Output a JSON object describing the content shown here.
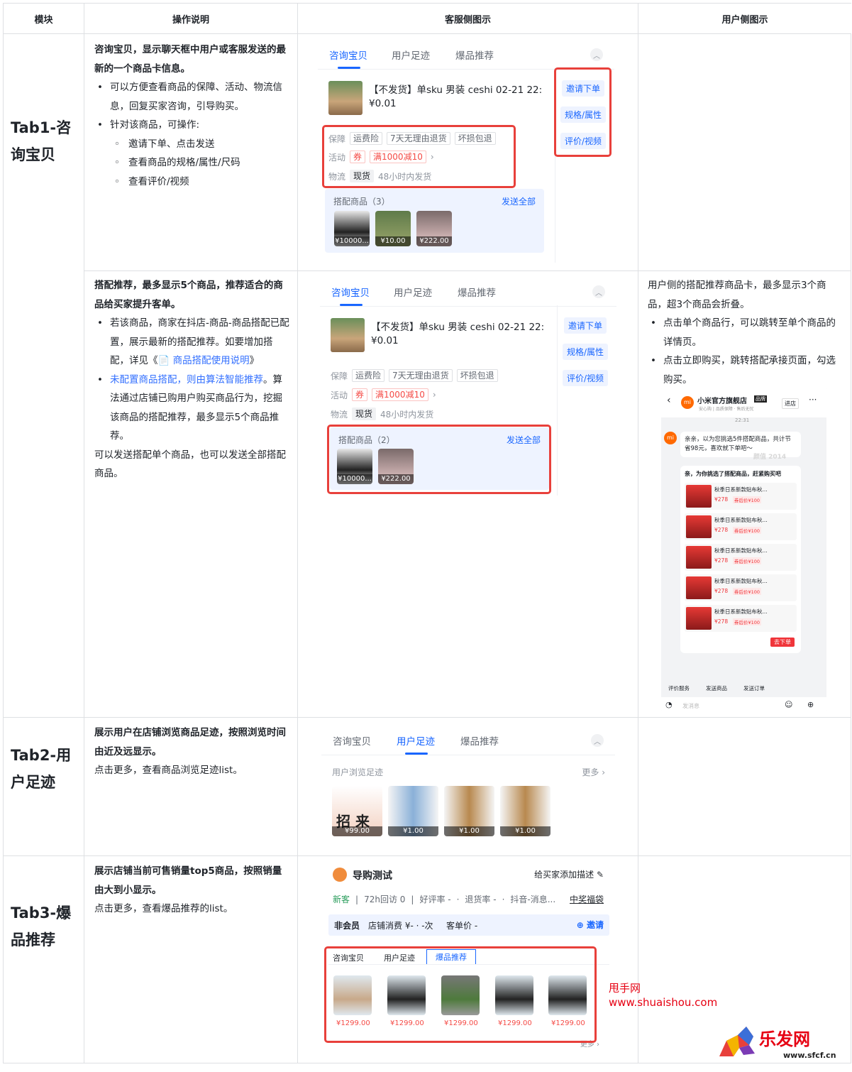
{
  "headers": {
    "module": "模块",
    "operation": "操作说明",
    "cs_view": "客服侧图示",
    "user_view": "用户侧图示"
  },
  "rows": {
    "tab1": {
      "module": "Tab1-咨询宝贝"
    },
    "tab2": {
      "module": "Tab2-用户足迹"
    },
    "tab3": {
      "module": "Tab3-爆品推荐"
    }
  },
  "ops": {
    "r1": {
      "lead": "咨询宝贝，显示聊天框中用户或客服发送的最新的一个商品卡信息。",
      "b1": "可以方便查看商品的保障、活动、物流信息，回复买家咨询，引导购买。",
      "b2": "针对该商品，可操作:",
      "s1": "邀请下单、点击发送",
      "s2": "查看商品的规格/属性/尺码",
      "s3": "查看评价/视频"
    },
    "r2": {
      "lead": "搭配推荐，最多显示5个商品，推荐适合的商品给买家提升客单。",
      "b1": "若该商品，商家在抖店-商品-商品搭配已配置，展示最新的搭配推荐。如要增加搭配，详见《",
      "b1_link": "📄 商品搭配使用说明",
      "b1_end": "》",
      "b2_link": "未配置商品搭配，则由算法智能推荐",
      "b2_rest": "。算法通过店铺已购用户购买商品行为，挖掘该商品的搭配推荐，最多显示5个商品推荐。",
      "tail": "可以发送搭配单个商品，也可以发送全部搭配商品。"
    },
    "r3": {
      "lead": "展示用户在店铺浏览商品足迹，按照浏览时间由近及远显示。",
      "tail": "点击更多，查看商品浏览足迹list。"
    },
    "r4": {
      "lead": "展示店铺当前可售销量top5商品，按照销量由大到小显示。",
      "tail": "点击更多，查看爆品推荐的list。"
    }
  },
  "panel": {
    "tabs": [
      "咨询宝贝",
      "用户足迹",
      "爆品推荐"
    ],
    "product_title": "【不发货】单sku 男装 ceshi 02-21 22:",
    "product_price": "¥0.01",
    "actions": [
      "邀请下单",
      "规格/属性",
      "评价/视频"
    ],
    "guarantee_label": "保障",
    "guarantee_chips": [
      "运费险",
      "7天无理由退货",
      "坏损包退"
    ],
    "activity_label": "活动",
    "activity_chip": "券",
    "activity_text": "满1000减10",
    "logistics_label": "物流",
    "logistics_chip": "现货",
    "logistics_text": "48小时内发货",
    "bundle_title_3": "搭配商品（3）",
    "bundle_title_2": "搭配商品（2）",
    "send_all": "发送全部",
    "bundle_prices_3": [
      "¥10000...",
      "¥10.00",
      "¥222.00"
    ],
    "bundle_prices_2": [
      "¥10000...",
      "¥222.00"
    ]
  },
  "footprint": {
    "title": "用户浏览足迹",
    "more": "更多 ›",
    "prices": [
      "¥99.00",
      "¥1.00",
      "¥1.00",
      "¥1.00"
    ],
    "cat_text": "招 来"
  },
  "hot": {
    "shop": "导购测试",
    "add_desc": "给买家添加描述",
    "stats": [
      "新客",
      "72h回访 0",
      "好评率 -",
      "退货率 -",
      "抖音-消息..."
    ],
    "lottery": "中奖福袋",
    "member": "非会员",
    "spend": "店铺消费 ¥- · -次",
    "unit": "客单价 -",
    "invite": "邀请",
    "tabs": [
      "咨询宝贝",
      "用户足迹",
      "爆品推荐"
    ],
    "prices": [
      "¥1299.00",
      "¥1299.00",
      "¥1299.00",
      "¥1299.00",
      "¥1299.00"
    ],
    "more": "更多 ›"
  },
  "user_note": {
    "lead": "用户侧的搭配推荐商品卡，最多显示3个商品，超3个商品会折叠。",
    "b1": "点击单个商品行，可以跳转至单个商品的详情页。",
    "b2": "点击立即购买，跳转搭配承接页面，勾选购买。"
  },
  "phone": {
    "shop": "小米官方旗舰店",
    "badge": "品牌",
    "enter": "进店",
    "sub": "安心购 | 品质保障 · 售后无忧",
    "time": "22:31",
    "msg": "亲亲，以为您挑选5件搭配商品，共计节省98元，喜欢就下单吧～",
    "card_title": "亲，为你挑选了搭配商品，赶紧购买吧",
    "item_name": "秋季日系新款贴布秋...",
    "item_price": "¥278",
    "item_after": "券后价¥100",
    "buy": "去下单",
    "bottom": [
      "评价服务",
      "发送商品",
      "发送订单"
    ],
    "input": "发消息",
    "watermark": "颜值 2014"
  },
  "watermarks": {
    "site1": "甩手网",
    "site2": "www.shuaishou.com",
    "logo_text": "乐发网",
    "logo_url": "www.sfcf.cn"
  }
}
